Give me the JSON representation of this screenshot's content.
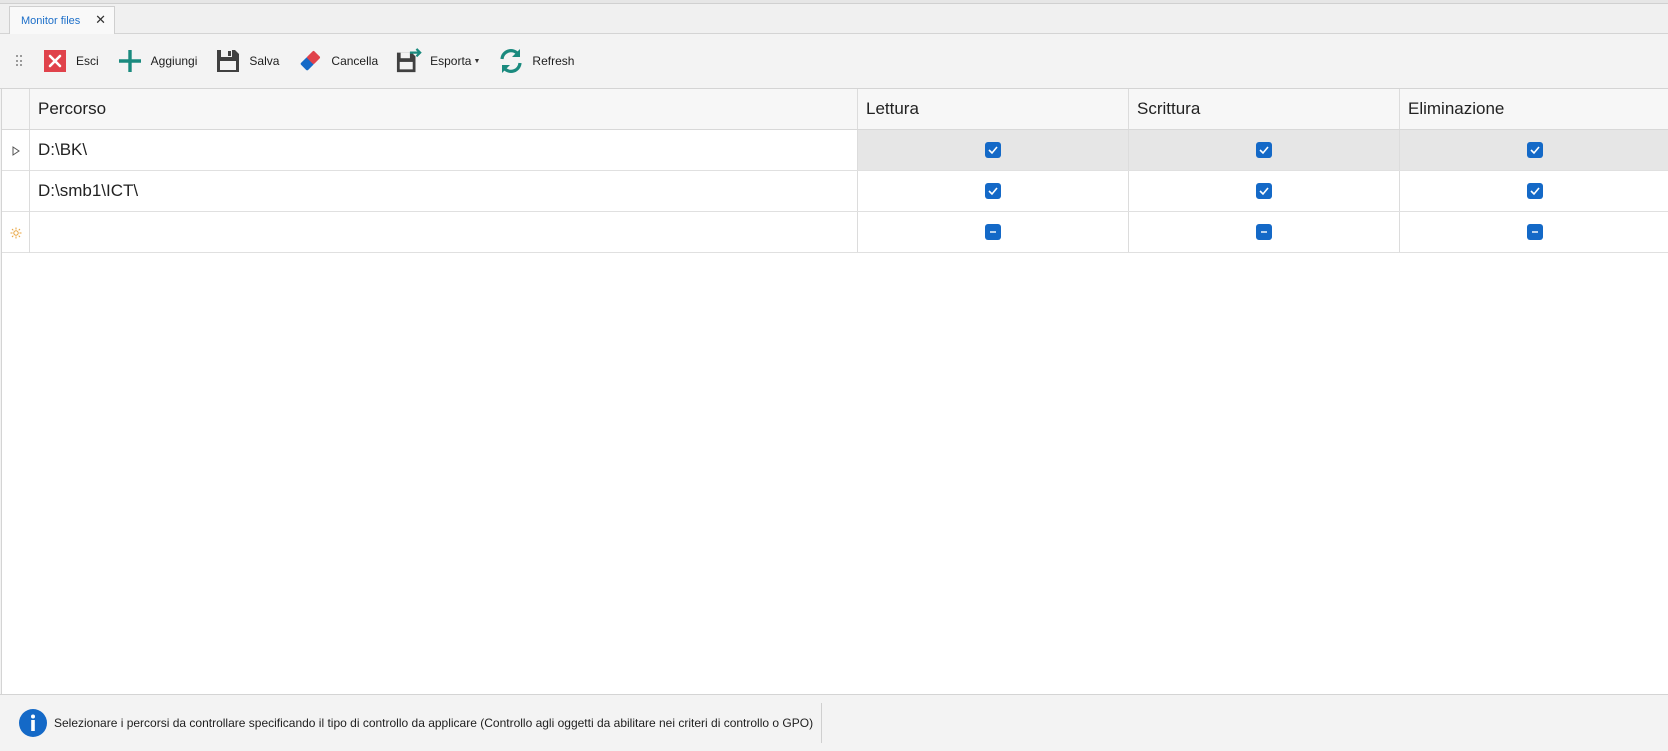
{
  "tabs": [
    {
      "label": "Monitor files",
      "active": true,
      "close_glyph": "✕"
    }
  ],
  "toolbar": {
    "buttons": [
      {
        "id": "exit",
        "label": "Esci",
        "icon": "close-x-icon",
        "color": "#e0424b"
      },
      {
        "id": "add",
        "label": "Aggiungi",
        "icon": "plus-icon",
        "color": "#1a8a7e"
      },
      {
        "id": "save",
        "label": "Salva",
        "icon": "floppy-disk-icon",
        "color": "#404040"
      },
      {
        "id": "delete",
        "label": "Cancella",
        "icon": "eraser-icon",
        "color": "#e0424b"
      },
      {
        "id": "export",
        "label": "Esporta",
        "icon": "export-disk-icon",
        "color": "#404040",
        "dropdown": true
      },
      {
        "id": "refresh",
        "label": "Refresh",
        "icon": "refresh-icon",
        "color": "#1a8a7e"
      }
    ]
  },
  "grid": {
    "columns": [
      "Percorso",
      "Lettura",
      "Scrittura",
      "Eliminazione"
    ],
    "rows": [
      {
        "path": "D:\\BK\\",
        "lettura": "checked",
        "scrittura": "checked",
        "eliminazione": "checked",
        "indicator": "current-row-arrow-icon",
        "selected": true
      },
      {
        "path": "D:\\smb1\\ICT\\",
        "lettura": "checked",
        "scrittura": "checked",
        "eliminazione": "checked",
        "indicator": "",
        "selected": false
      },
      {
        "path": "",
        "lettura": "indeterminate",
        "scrittura": "indeterminate",
        "eliminazione": "indeterminate",
        "indicator": "new-row-icon",
        "selected": false
      }
    ]
  },
  "status": {
    "icon": "info-icon",
    "message": "Selezionare i percorsi da controllare specificando il tipo di controllo da applicare (Controllo agli oggetti da abilitare nei criteri di controllo o GPO)"
  },
  "colors": {
    "accent": "#1469c7",
    "tab_text": "#1d6fc9",
    "selected_row": "#e6e6e6"
  }
}
